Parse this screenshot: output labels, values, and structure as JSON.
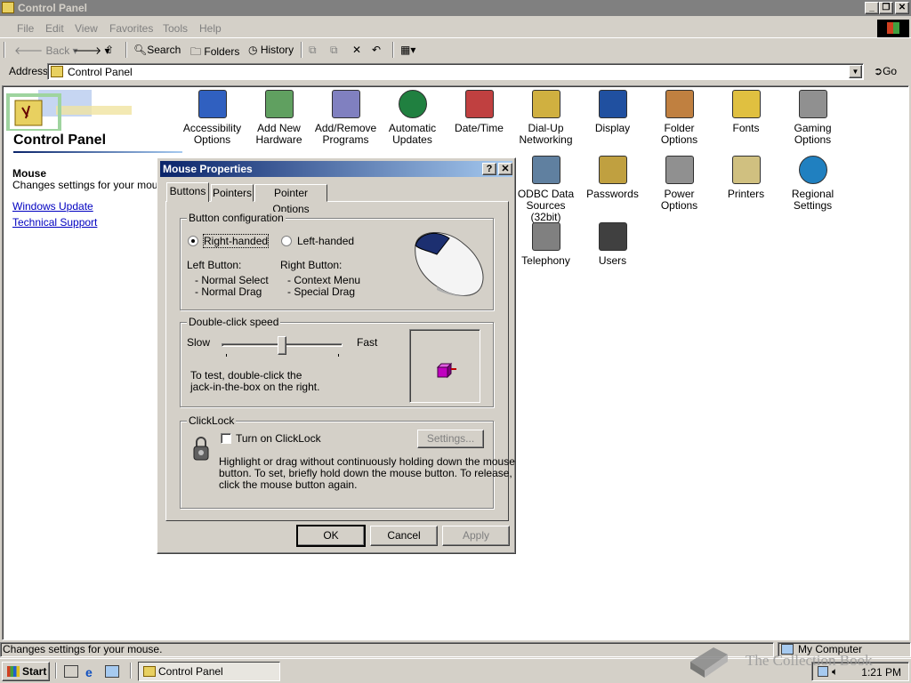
{
  "window": {
    "title": "Control Panel"
  },
  "menu": {
    "items": [
      "File",
      "Edit",
      "View",
      "Favorites",
      "Tools",
      "Help"
    ]
  },
  "toolbar": {
    "back": "Back",
    "search": "Search",
    "folders": "Folders",
    "history": "History"
  },
  "address": {
    "label": "Address",
    "value": "Control Panel",
    "go": "Go"
  },
  "left_pane": {
    "title": "Control Panel",
    "selected_name": "Mouse",
    "selected_desc": "Changes settings for your mouse.",
    "links": [
      "Windows Update",
      "Technical Support"
    ]
  },
  "icons": [
    {
      "label": "Accessibility Options",
      "icon": "accessibility-icon"
    },
    {
      "label": "Add New Hardware",
      "icon": "add-hardware-icon"
    },
    {
      "label": "Add/Remove Programs",
      "icon": "add-remove-programs-icon"
    },
    {
      "label": "Automatic Updates",
      "icon": "automatic-updates-icon"
    },
    {
      "label": "Date/Time",
      "icon": "date-time-icon"
    },
    {
      "label": "Dial-Up Networking",
      "icon": "dialup-networking-icon"
    },
    {
      "label": "Display",
      "icon": "display-icon"
    },
    {
      "label": "Folder Options",
      "icon": "folder-options-icon"
    },
    {
      "label": "Fonts",
      "icon": "fonts-icon"
    },
    {
      "label": "Gaming Options",
      "icon": "gaming-options-icon"
    },
    {
      "label": "ODBC Data Sources (32bit)",
      "icon": "odbc-icon"
    },
    {
      "label": "Passwords",
      "icon": "passwords-icon"
    },
    {
      "label": "Power Options",
      "icon": "power-options-icon"
    },
    {
      "label": "Printers",
      "icon": "printers-icon"
    },
    {
      "label": "Regional Settings",
      "icon": "regional-settings-icon"
    },
    {
      "label": "Telephony",
      "icon": "telephony-icon"
    },
    {
      "label": "Users",
      "icon": "users-icon"
    }
  ],
  "dialog": {
    "title": "Mouse Properties",
    "help": "?",
    "close": "✕",
    "tabs": [
      "Buttons",
      "Pointers",
      "Pointer Options"
    ],
    "button_config": {
      "label": "Button configuration",
      "right_handed": "Right-handed",
      "left_handed": "Left-handed",
      "selected": "Right-handed",
      "left_button": "Left Button:",
      "left_items": [
        "- Normal Select",
        "- Normal Drag"
      ],
      "right_button": "Right Button:",
      "right_items": [
        "- Context Menu",
        "- Special Drag"
      ]
    },
    "double_click": {
      "label": "Double-click speed",
      "slow": "Slow",
      "fast": "Fast",
      "speed_fraction": 0.5,
      "test_text_1": "To test, double-click the",
      "test_text_2": "jack-in-the-box on the right."
    },
    "clicklock": {
      "label": "ClickLock",
      "checkbox": "Turn on ClickLock",
      "checked": false,
      "settings": "Settings...",
      "desc": [
        "Highlight or drag without continuously holding down the mouse",
        "button. To set, briefly hold down the mouse button. To release,",
        "click the mouse button again."
      ]
    },
    "buttons": {
      "ok": "OK",
      "cancel": "Cancel",
      "apply": "Apply"
    }
  },
  "status": {
    "left": "Changes settings for your mouse.",
    "right": "My Computer"
  },
  "taskbar": {
    "start": "Start",
    "task": "Control Panel",
    "clock": "1:21 PM"
  },
  "watermark": {
    "text": "The Collection Book"
  }
}
